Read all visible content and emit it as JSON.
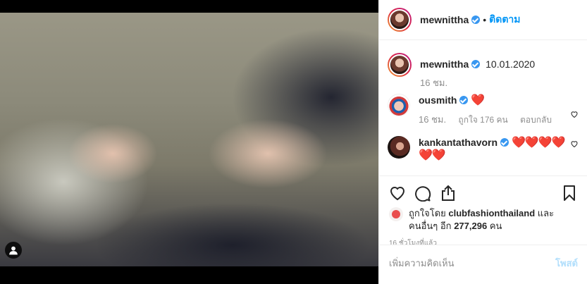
{
  "post": {
    "username": "mewnittha",
    "follow_label": "ติดตาม",
    "dot": "•"
  },
  "caption": {
    "username": "mewnittha",
    "text": "10.01.2020",
    "age": "16 ชม."
  },
  "comments": [
    {
      "username": "ousmith",
      "text": "❤️",
      "age": "16 ชม.",
      "likes": "ถูกใจ 176 คน",
      "reply": "ตอบกลับ"
    },
    {
      "username": "kankantathavorn",
      "text": "❤️❤️❤️❤️",
      "text2": "❤️❤️"
    }
  ],
  "likes": {
    "prefix": "ถูกใจโดย",
    "user": "clubfashionthailand",
    "and": "และ",
    "others_prefix": "คนอื่นๆ อีก",
    "count": "277,296",
    "suffix": "คน"
  },
  "timestamp": "16 ชั่วโมงที่แล้ว",
  "add_comment": {
    "placeholder": "เพิ่มความคิดเห็น",
    "post_label": "โพสต์"
  },
  "colors": {
    "verified": "#3897f0",
    "follow": "#0095f6",
    "heart": "#ed4956",
    "post_disabled": "#b2dffc"
  },
  "icons": [
    "person-icon",
    "heart-icon",
    "comment-icon",
    "share-icon",
    "bookmark-icon",
    "verified-icon"
  ]
}
